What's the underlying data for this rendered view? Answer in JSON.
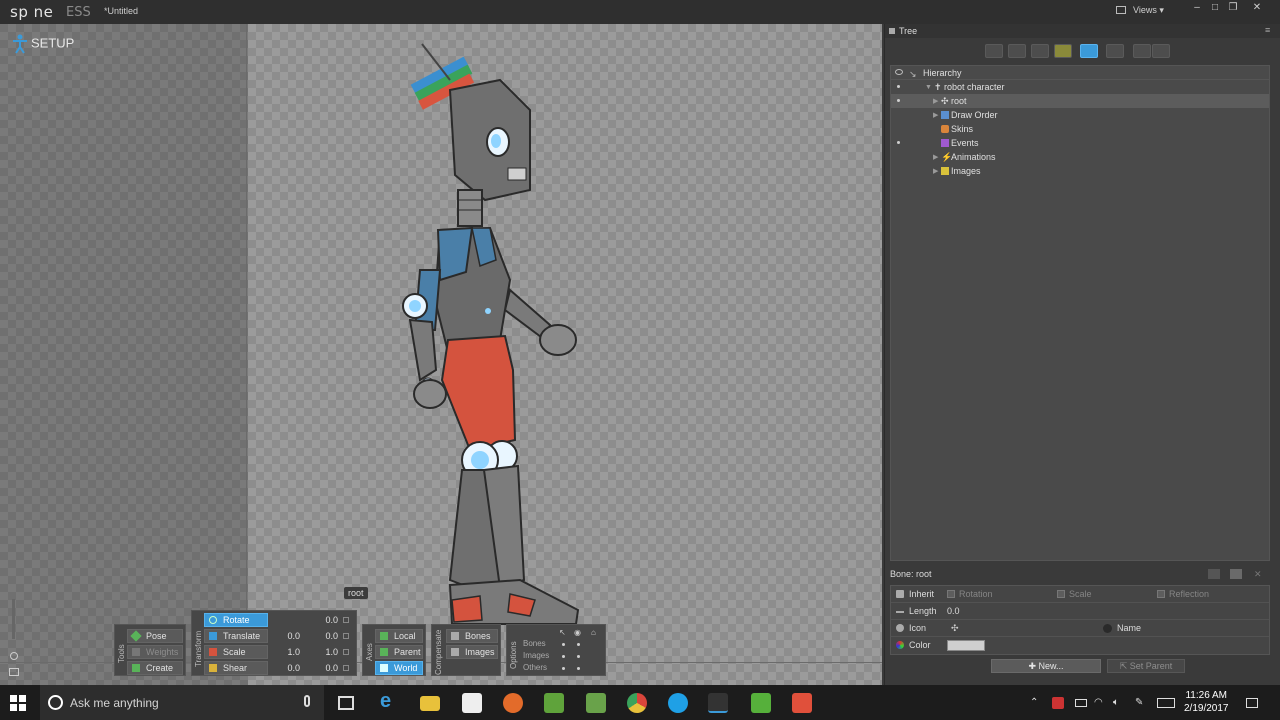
{
  "app": {
    "logo": "sp ne",
    "edition": "ESS",
    "filename": "*Untitled",
    "views_label": "Views",
    "mode": "SETUP"
  },
  "viewport": {
    "bone_tag": "root"
  },
  "tools": {
    "section_label": "Tools",
    "pose": "Pose",
    "weights": "Weights",
    "create": "Create"
  },
  "transform": {
    "section_label": "Transform",
    "rotate": {
      "label": "Rotate",
      "value": "0.0"
    },
    "translate": {
      "label": "Translate",
      "x": "0.0",
      "y": "0.0"
    },
    "scale": {
      "label": "Scale",
      "x": "1.0",
      "y": "1.0"
    },
    "shear": {
      "label": "Shear",
      "x": "0.0",
      "y": "0.0"
    }
  },
  "axes": {
    "section_label": "Axes",
    "local": "Local",
    "parent": "Parent",
    "world": "World"
  },
  "compensate": {
    "section_label": "Compensate",
    "bones": "Bones",
    "images": "Images"
  },
  "options": {
    "section_label": "Options",
    "rows": [
      "Bones",
      "Images",
      "Others"
    ]
  },
  "tree": {
    "title": "Tree",
    "hierarchy_label": "Hierarchy",
    "items": [
      {
        "label": "robot character",
        "icon": "skeleton-icon"
      },
      {
        "label": "root",
        "icon": "bone-icon"
      },
      {
        "label": "Draw Order",
        "icon": "draw-order-icon"
      },
      {
        "label": "Skins",
        "icon": "skins-icon"
      },
      {
        "label": "Events",
        "icon": "events-icon"
      },
      {
        "label": "Animations",
        "icon": "animations-icon"
      },
      {
        "label": "Images",
        "icon": "folder-icon"
      }
    ]
  },
  "properties": {
    "header": "Bone: root",
    "inherit_label": "Inherit",
    "rotation_label": "Rotation",
    "scale_label": "Scale",
    "reflection_label": "Reflection",
    "length_label": "Length",
    "length_value": "0.0",
    "icon_label": "Icon",
    "name_label": "Name",
    "color_label": "Color",
    "color_value": "#cfcfcf",
    "new_button": "New...",
    "set_parent_button": "Set Parent"
  },
  "taskbar": {
    "search_placeholder": "Ask me anything",
    "time": "11:26 AM",
    "date": "2/19/2017"
  },
  "colors": {
    "accent": "#3b9ad9",
    "robot_body": "#6f6f6f",
    "robot_pants": "#d4533e",
    "robot_arm": "#4a7fa8"
  }
}
